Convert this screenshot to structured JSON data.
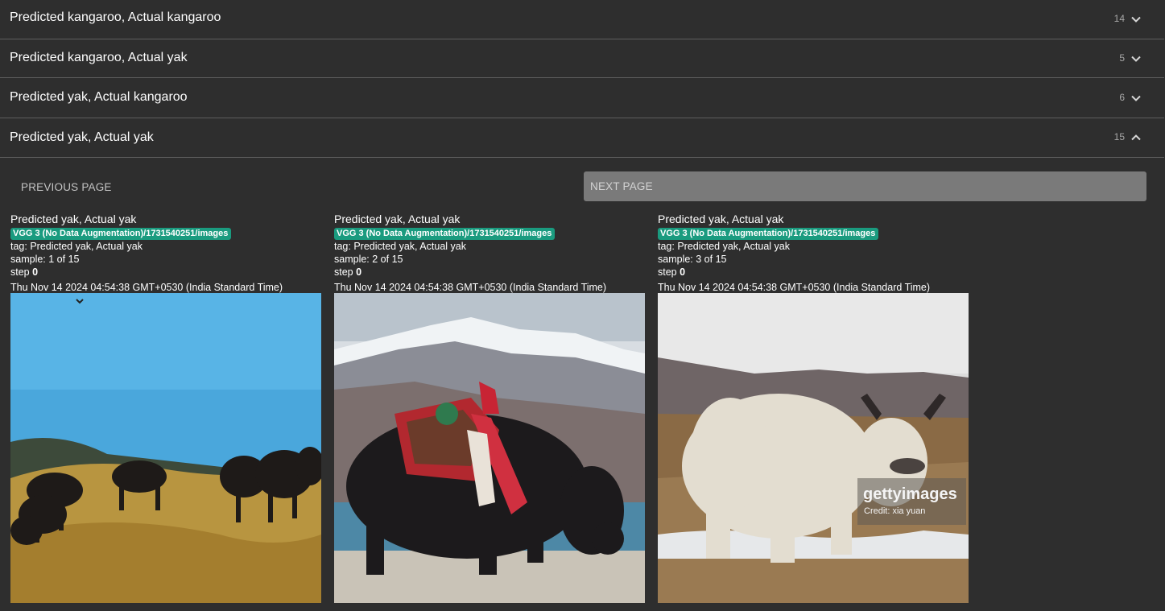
{
  "groups": [
    {
      "title": "Predicted kangaroo, Actual kangaroo",
      "count": "14",
      "expanded": false
    },
    {
      "title": "Predicted kangaroo, Actual yak",
      "count": "5",
      "expanded": false
    },
    {
      "title": "Predicted yak, Actual kangaroo",
      "count": "6",
      "expanded": false
    },
    {
      "title": "Predicted yak, Actual yak",
      "count": "15",
      "expanded": true
    }
  ],
  "pagination": {
    "previous_label": "PREVIOUS PAGE",
    "next_label": "NEXT PAGE"
  },
  "cards": [
    {
      "title": "Predicted yak, Actual yak",
      "run": "VGG 3 (No Data Augmentation)/1731540251/images",
      "tag": "tag: Predicted yak, Actual yak",
      "sample": "sample: 1 of 15",
      "step_label": "step",
      "step_value": "0",
      "timestamp": "Thu Nov 14 2024 04:54:38 GMT+0530 (India Standard Time)"
    },
    {
      "title": "Predicted yak, Actual yak",
      "run": "VGG 3 (No Data Augmentation)/1731540251/images",
      "tag": "tag: Predicted yak, Actual yak",
      "sample": "sample: 2 of 15",
      "step_label": "step",
      "step_value": "0",
      "timestamp": "Thu Nov 14 2024 04:54:38 GMT+0530 (India Standard Time)"
    },
    {
      "title": "Predicted yak, Actual yak",
      "run": "VGG 3 (No Data Augmentation)/1731540251/images",
      "tag": "tag: Predicted yak, Actual yak",
      "sample": "sample: 3 of 15",
      "step_label": "step",
      "step_value": "0",
      "timestamp": "Thu Nov 14 2024 04:54:38 GMT+0530 (India Standard Time)",
      "watermark": "gettyimages",
      "watermark_credit": "Credit: xia yuan"
    }
  ],
  "colors": {
    "background": "#2e2e2e",
    "divider": "#5e5e5e",
    "run_badge": "#1a9b7f",
    "next_button": "#7a7a7a"
  },
  "icons": {
    "collapsed": "chevron-down-icon",
    "expanded": "chevron-up-icon"
  }
}
